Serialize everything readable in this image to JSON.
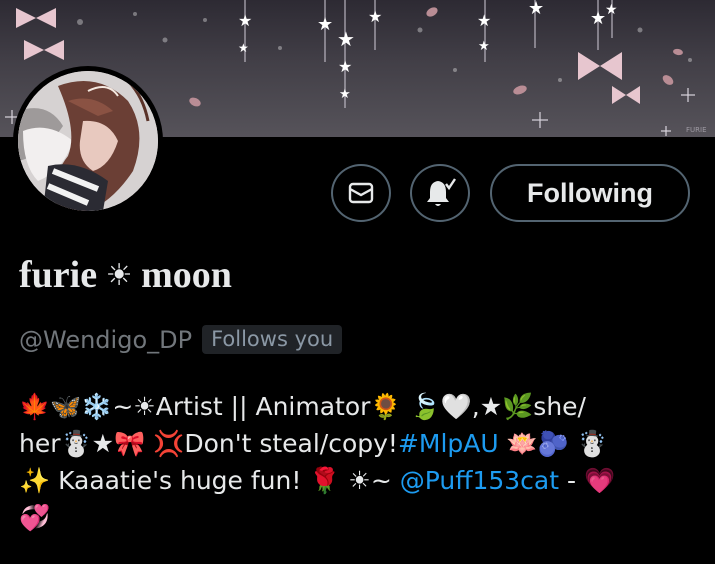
{
  "banner": {
    "signature": "FURIE"
  },
  "actions": {
    "message_icon": "envelope-icon",
    "notify_icon": "bell-check-icon",
    "following_label": "Following"
  },
  "profile": {
    "name_part1": "furie",
    "name_separator": "☀",
    "name_part2": "moon",
    "handle": "@Wendigo_DP",
    "follows_badge": "Follows you"
  },
  "bio": {
    "l1_e1": "🍁",
    "l1_e2": "🦋",
    "l1_e3": "❄️",
    "l1_text1": "~☀Artist || Animator",
    "l1_e4": "🌻",
    "l1_e5": "🍃",
    "l1_e6": "🤍",
    "l1_text2": ",★",
    "l1_e7": "🌿",
    "l1_text3": "she/",
    "l2_text1": "her",
    "l2_e1": "☃️",
    "l2_text2": "★",
    "l2_e2": "🎀",
    "l2_e3": "💢",
    "l2_text3": "Don't steal/copy!",
    "l2_hashtag": "#MlpAU",
    "l2_e4": "🪷",
    "l2_e5": "🫐",
    "l2_e6": "☃️",
    "l3_e1": "✨",
    "l3_text1": " Kaaatie's huge fun! ",
    "l3_e2": "🌹",
    "l3_text2": " ☀~ ",
    "l3_mention": "@Puff153cat",
    "l3_text3": " - ",
    "l3_e3": "💗",
    "l4_e1": "💞"
  },
  "colors": {
    "accent_blue": "#1d9bf0",
    "text": "#e7e9ea",
    "muted": "#71767b",
    "border": "#536471"
  }
}
